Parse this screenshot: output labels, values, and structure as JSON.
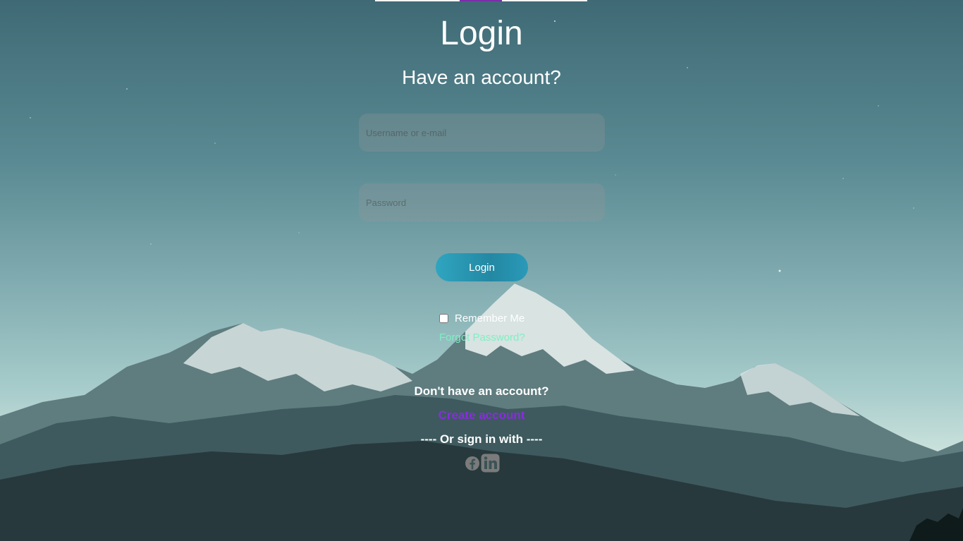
{
  "header": {
    "title": "Login",
    "subtitle": "Have an account?"
  },
  "form": {
    "username_placeholder": "Username or e-mail",
    "password_placeholder": "Password",
    "login_label": "Login",
    "remember_label": "Remember Me",
    "remember_checked": false,
    "forgot_label": "Forgot Password?"
  },
  "signup": {
    "prompt": "Don't have an account?",
    "create_label": "Create account",
    "or_sign_in": "---- Or sign in with ----"
  },
  "social": [
    {
      "name": "facebook-icon"
    },
    {
      "name": "linkedin-icon"
    }
  ],
  "colors": {
    "accent_purple": "#8a2be2",
    "forgot_link": "#7ef0c3",
    "login_button": "#2388a3"
  }
}
